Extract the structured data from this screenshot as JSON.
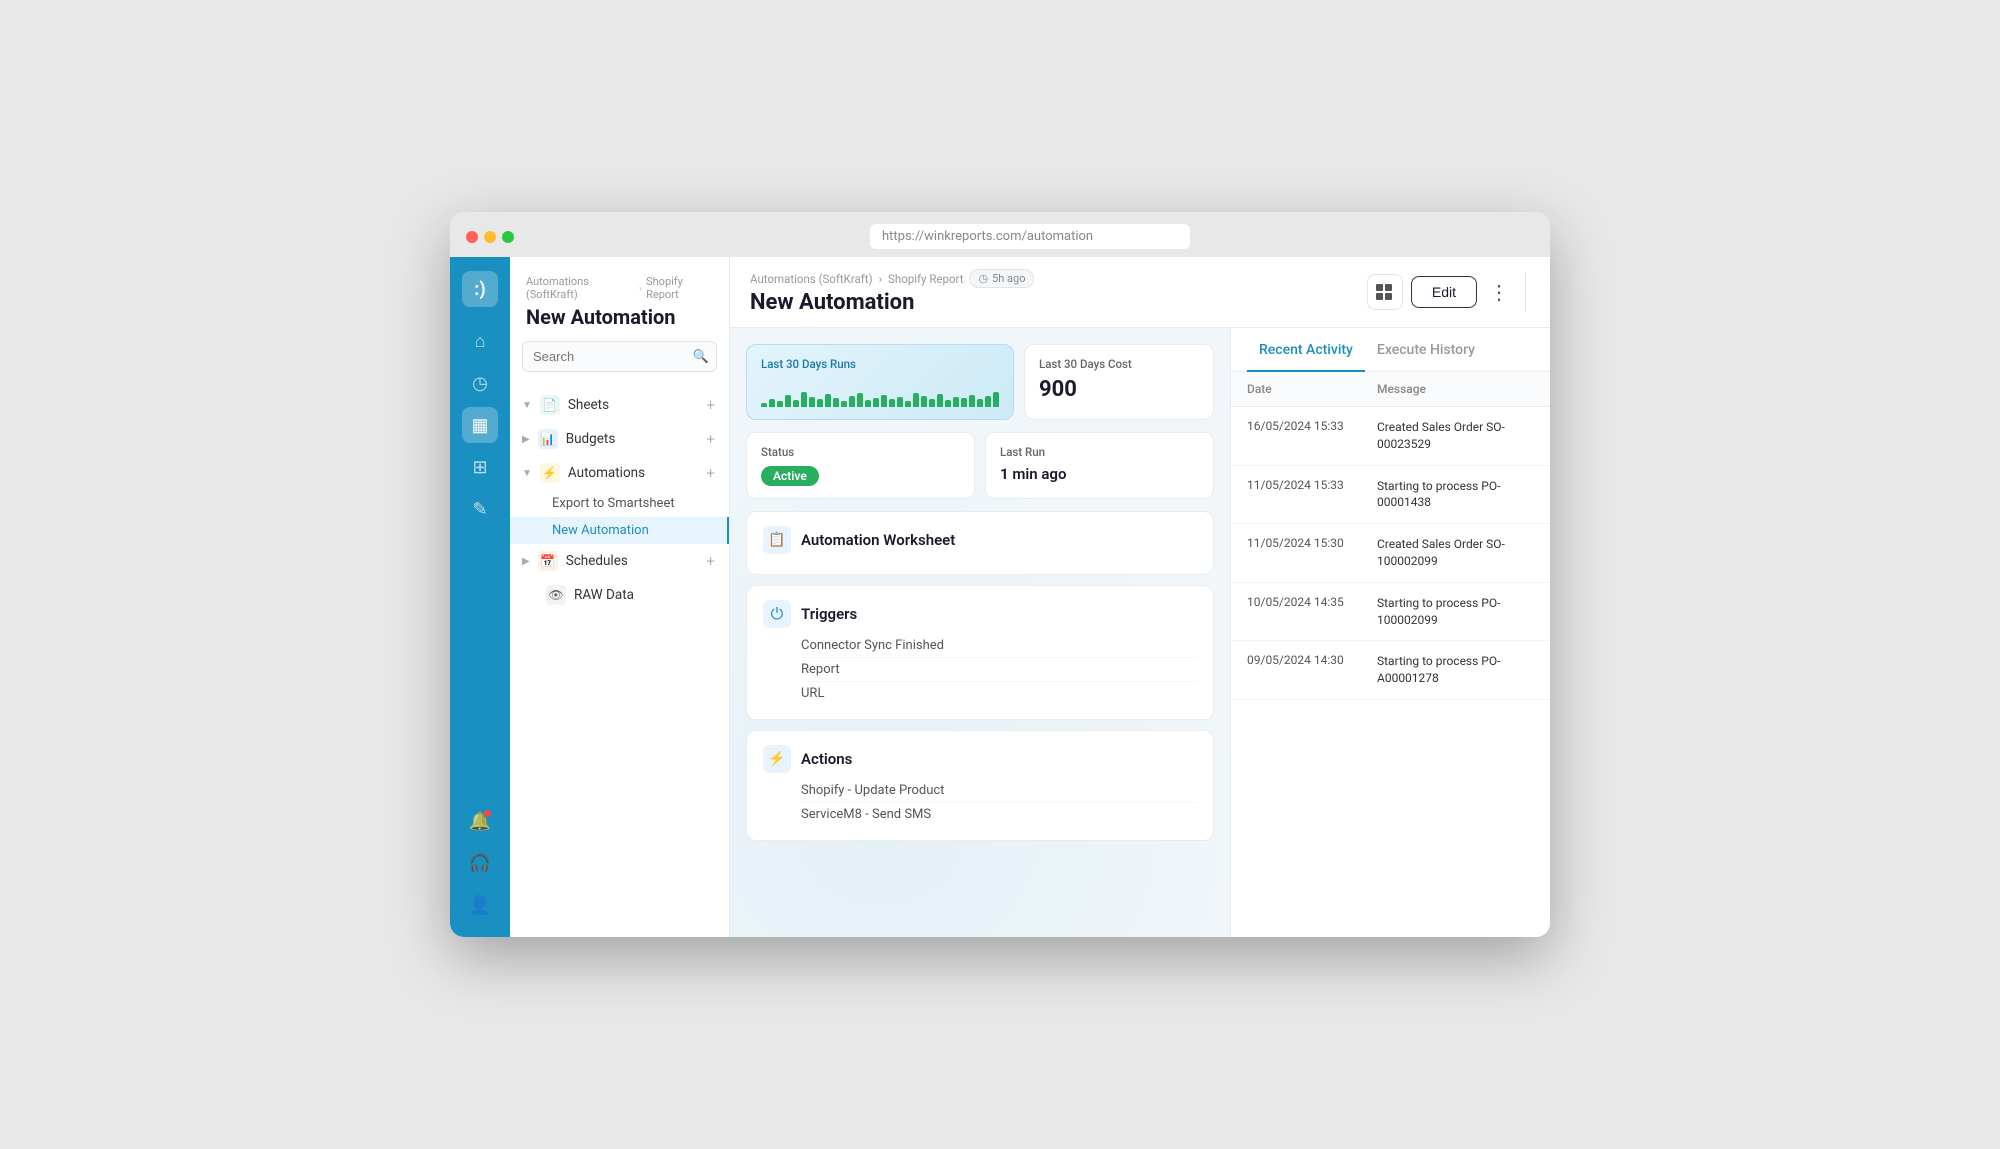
{
  "browser": {
    "url_prefix": "https://",
    "url_domain": "winkreports.com",
    "url_path": "/automation"
  },
  "sidebar_nav": {
    "logo": ":)",
    "icons": [
      {
        "name": "home-icon",
        "symbol": "⌂",
        "active": false
      },
      {
        "name": "clock-icon",
        "symbol": "◷",
        "active": false
      },
      {
        "name": "sheet-icon",
        "symbol": "▦",
        "active": true
      },
      {
        "name": "grid-icon",
        "symbol": "⊞",
        "active": false
      },
      {
        "name": "tool-icon",
        "symbol": "⚙",
        "active": false
      }
    ],
    "bottom_icons": [
      {
        "name": "bell-icon",
        "symbol": "🔔",
        "notification": true
      },
      {
        "name": "headset-icon",
        "symbol": "🎧"
      },
      {
        "name": "user-icon",
        "symbol": "👤"
      }
    ]
  },
  "content_sidebar": {
    "breadcrumb_parts": [
      "Automations (SoftKraft)",
      ">",
      "Shopify Report"
    ],
    "page_title": "New Automation",
    "search_placeholder": "Search",
    "nav_items": [
      {
        "id": "sheets",
        "label": "Sheets",
        "icon": "📄",
        "icon_type": "green",
        "expanded": true,
        "has_plus": true,
        "children": []
      },
      {
        "id": "budgets",
        "label": "Budgets",
        "icon": "📊",
        "icon_type": "blue",
        "expanded": false,
        "has_plus": true,
        "children": []
      },
      {
        "id": "automations",
        "label": "Automations",
        "icon": "⚡",
        "icon_type": "yellow",
        "expanded": true,
        "has_plus": true,
        "children": [
          {
            "label": "Export to Smartsheet",
            "active": false
          },
          {
            "label": "New Automation",
            "active": true
          }
        ]
      },
      {
        "id": "schedules",
        "label": "Schedules",
        "icon": "📅",
        "icon_type": "orange",
        "expanded": false,
        "has_plus": true,
        "children": []
      },
      {
        "id": "rawdata",
        "label": "RAW Data",
        "icon": "👁",
        "icon_type": "gray",
        "expanded": false,
        "has_plus": false,
        "children": []
      }
    ]
  },
  "header": {
    "breadcrumb": [
      "Automations (SoftKraft)",
      ">",
      "Shopify Report"
    ],
    "time_ago": "5h ago",
    "title": "New Automation",
    "edit_label": "Edit"
  },
  "stats": {
    "runs_label": "Last 30 Days Runs",
    "cost_label": "Last 30 Days Cost",
    "cost_value": "900",
    "status_label": "Status",
    "status_value": "Active",
    "last_run_label": "Last Run",
    "last_run_value": "1 min ago",
    "bars": [
      4,
      8,
      6,
      12,
      7,
      15,
      10,
      8,
      13,
      9,
      6,
      11,
      14,
      7,
      9,
      12,
      8,
      10,
      6,
      14,
      11,
      8,
      13,
      7,
      10,
      9,
      12,
      8,
      11,
      15
    ]
  },
  "automation_worksheet": {
    "title": "Automation Worksheet",
    "icon": "📋"
  },
  "triggers": {
    "title": "Triggers",
    "icon": "⏻",
    "items": [
      "Connector Sync Finished",
      "Report",
      "URL"
    ]
  },
  "actions": {
    "title": "Actions",
    "icon": "⚡",
    "items": [
      "Shopify - Update Product",
      "ServiceM8 - Send SMS"
    ]
  },
  "activity": {
    "tabs": [
      "Recent Activity",
      "Execute History"
    ],
    "active_tab": "Recent Activity",
    "col_date": "Date",
    "col_message": "Message",
    "rows": [
      {
        "date": "16/05/2024 15:33",
        "message": "Created Sales Order SO-00023529"
      },
      {
        "date": "11/05/2024 15:33",
        "message": "Starting to process PO-00001438"
      },
      {
        "date": "11/05/2024 15:30",
        "message": "Created Sales Order SO-100002099"
      },
      {
        "date": "10/05/2024 14:35",
        "message": "Starting to process PO-100002099"
      },
      {
        "date": "09/05/2024 14:30",
        "message": "Starting to process PO-A00001278"
      }
    ]
  }
}
